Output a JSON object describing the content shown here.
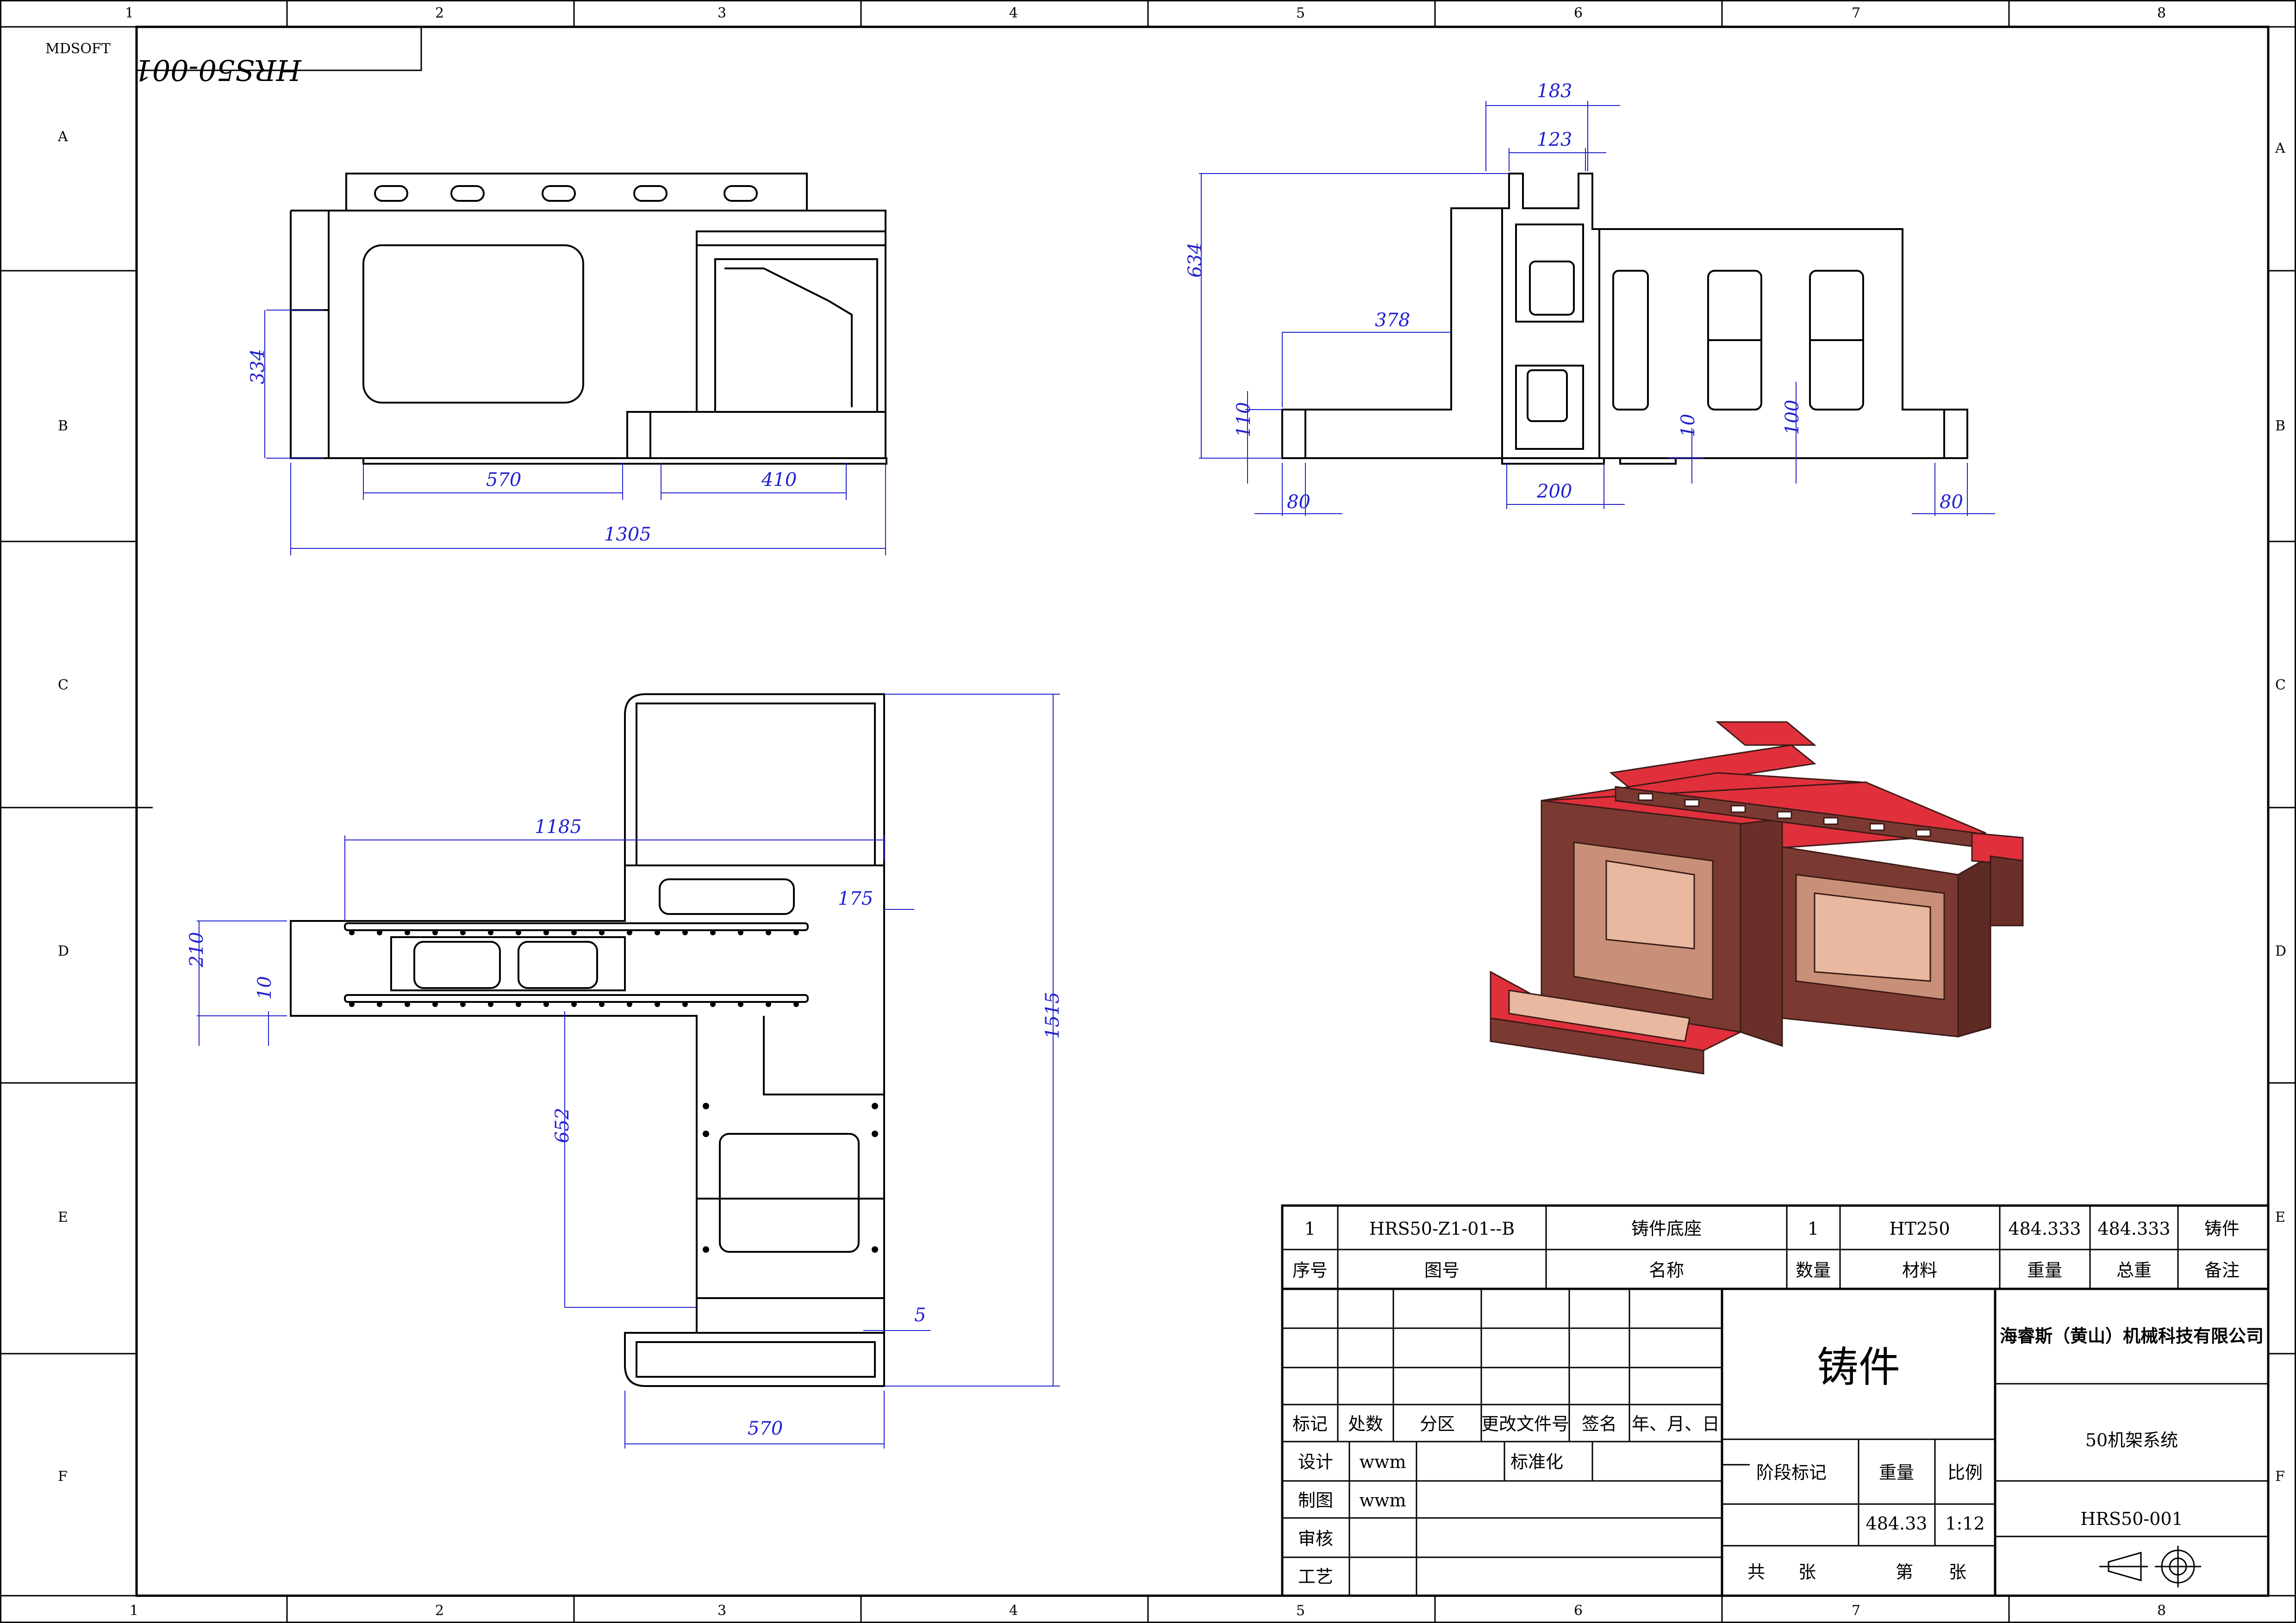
{
  "software_label": "MDSOFT",
  "drawing_no_corner": "HRS50-001",
  "zone_cols": [
    "1",
    "2",
    "3",
    "4",
    "5",
    "6",
    "7",
    "8"
  ],
  "zone_rows": [
    "A",
    "B",
    "C",
    "D",
    "E",
    "F"
  ],
  "dims": {
    "front": {
      "d334": "334",
      "d570": "570",
      "d410": "410",
      "d1305": "1305"
    },
    "side": {
      "d183": "183",
      "d123": "123",
      "d634": "634",
      "d378": "378",
      "d110": "110",
      "d80a": "80",
      "d200": "200",
      "d10": "10",
      "d100": "100",
      "d80b": "80"
    },
    "top": {
      "d1185": "1185",
      "d175": "175",
      "d210": "210",
      "d10": "10",
      "d652": "652",
      "d1515": "1515",
      "d5": "5",
      "d570": "570"
    }
  },
  "bom": {
    "row": {
      "seq": "1",
      "drawing_no": "HRS50-Z1-01--B",
      "name": "铸件底座",
      "qty": "1",
      "material": "HT250",
      "weight": "484.333",
      "total": "484.333",
      "note": "铸件"
    },
    "header": {
      "seq": "序号",
      "drawing_no": "图号",
      "name": "名称",
      "qty": "数量",
      "material": "材料",
      "weight": "重量",
      "total": "总重",
      "note": "备注"
    }
  },
  "title_block": {
    "rev_headers": {
      "mark": "标记",
      "count": "处数",
      "zone": "分区",
      "doc": "更改文件号",
      "sign": "签名",
      "date": "年、月、日"
    },
    "design_label": "设计",
    "design_name": "wwm",
    "drawn_label": "制图",
    "drawn_name": "wwm",
    "check_label": "审核",
    "process_label": "工艺",
    "std_label": "标准化",
    "material_big": "铸件",
    "stage_label": "阶段标记",
    "weight_label": "重量",
    "scale_label": "比例",
    "weight_value": "484.33",
    "scale_value": "1:12",
    "total_sheets": "共",
    "sheet_unit_a": "张",
    "sheet_no": "第",
    "sheet_unit_b": "张",
    "company": "海睿斯（黄山）机械科技有限公司",
    "part_name": "50机架系统",
    "drawing_no": "HRS50-001"
  },
  "colors": {
    "line": "#000000",
    "dim": "#2020d0",
    "cast_dark": "#7a3a32",
    "cast_red": "#e0303c",
    "cast_light": "#e8b8a0"
  }
}
